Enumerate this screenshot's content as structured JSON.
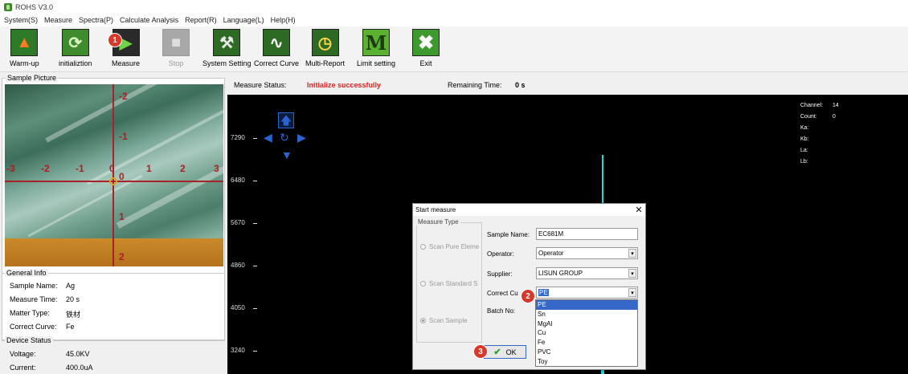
{
  "window": {
    "title": "ROHS V3.0"
  },
  "menu": [
    "System(S)",
    "Measure",
    "Spectra(P)",
    "Calculate Analysis",
    "Report(R)",
    "Language(L)",
    "Help(H)"
  ],
  "toolbar": {
    "warmup": {
      "label": "Warm-up",
      "icon": "flame-icon"
    },
    "init": {
      "label": "initializtion",
      "icon": "refresh-icon"
    },
    "measure": {
      "label": "Measure",
      "icon": "play-icon"
    },
    "stop": {
      "label": "Stop",
      "icon": "stop-icon"
    },
    "system_setting": {
      "label": "System Setting",
      "icon": "hammer-icon"
    },
    "correct_curve": {
      "label": "Correct Curve",
      "icon": "waveform-icon"
    },
    "multi_report": {
      "label": "Multi-Report",
      "icon": "clock-icon"
    },
    "limit_setting": {
      "label": "Limit setting",
      "icon": "letter-m-icon"
    },
    "exit": {
      "label": "Exit",
      "icon": "close-x-icon"
    }
  },
  "badges": [
    "1",
    "2",
    "3"
  ],
  "sample_picture": {
    "title": "Sample Picture",
    "y_ticks": [
      "-2",
      "-1",
      "0",
      "1",
      "2"
    ],
    "x_ticks": [
      "-3",
      "-2",
      "-1",
      "0",
      "1",
      "2",
      "3"
    ]
  },
  "general_info": {
    "title": "General Info",
    "rows": [
      {
        "label": "Sample Name:",
        "value": "Ag"
      },
      {
        "label": "Measure Time:",
        "value": "20 s"
      },
      {
        "label": "Matter Type:",
        "value": "铁材"
      },
      {
        "label": "Correct Curve:",
        "value": "Fe"
      }
    ]
  },
  "device_status": {
    "title": "Device Status",
    "rows": [
      {
        "label": "Voltage:",
        "value": "45.0KV"
      },
      {
        "label": "Current:",
        "value": "400.0uA"
      }
    ]
  },
  "status": {
    "label": "Measure Status:",
    "value": "Initialize successfully",
    "time_label": "Remaining Time:",
    "time_value": "0 s"
  },
  "spectrum": {
    "y_ticks": [
      "7290",
      "6480",
      "5670",
      "4860",
      "4050",
      "3240"
    ],
    "channel_info": [
      {
        "label": "Channel:",
        "value": "14"
      },
      {
        "label": "Count:",
        "value": "0"
      },
      {
        "label": "Ka:",
        "value": ""
      },
      {
        "label": "Kb:",
        "value": ""
      },
      {
        "label": "La:",
        "value": ""
      },
      {
        "label": "Lb:",
        "value": ""
      }
    ]
  },
  "dialog": {
    "title": "Start measure",
    "measure_type_title": "Measure Type",
    "radios": [
      "Scan Pure Eleme",
      "Scan Standard S",
      "Scan Sample"
    ],
    "sample_name_label": "Sample Name:",
    "sample_name_value": "EC681M",
    "operator_label": "Operator:",
    "operator_value": "Operator",
    "supplier_label": "Supplier:",
    "supplier_value": "LISUN GROUP",
    "correct_curve_label": "Correct Cu",
    "correct_curve_value": "PE",
    "batch_label": "Batch No:",
    "dropdown_options": [
      "PE",
      "Sn",
      "MgAl",
      "Cu",
      "Fe",
      "PVC",
      "Toy"
    ],
    "ok_label": "OK"
  },
  "colors": {
    "status_red": "#e02020",
    "spectrum_cyan": "#22d6d6",
    "badge_red": "#d8382a"
  }
}
